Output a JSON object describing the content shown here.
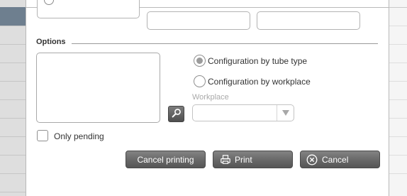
{
  "options": {
    "title": "Options",
    "radio_by_tube_type": {
      "label": "Configuration by tube type",
      "selected": true
    },
    "radio_by_workplace": {
      "label": "Configuration by workplace",
      "selected": false
    },
    "workplace": {
      "label": "Workplace",
      "value": ""
    },
    "only_pending": {
      "label": "Only pending",
      "checked": false
    }
  },
  "buttons": {
    "cancel_printing": "Cancel printing",
    "print": "Print",
    "cancel": "Cancel"
  },
  "icons": {
    "search": "search-icon",
    "print": "printer-icon",
    "cancel": "close-circle-icon",
    "dropdown": "chevron-down-icon"
  },
  "colors": {
    "sidebar_selected": "#6e7f8f",
    "button_bg": "#6a6a6a",
    "radio_dot": "#9b9b9b"
  }
}
